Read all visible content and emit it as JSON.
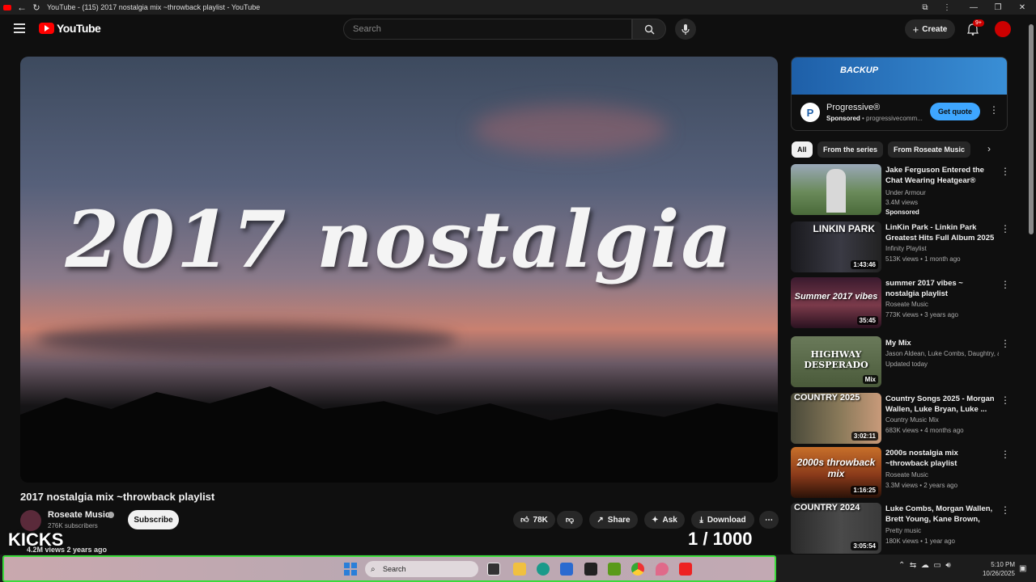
{
  "window": {
    "title": "YouTube - (115) 2017 nostalgia mix ~throwback playlist - YouTube",
    "controls": [
      "—",
      "❐",
      "✕"
    ]
  },
  "header": {
    "brand": "YouTube",
    "search_placeholder": "Search",
    "create_label": "Create",
    "notif_count": "9+"
  },
  "player": {
    "overlay_text": "2017 nostalgia",
    "overlay_bottom_left": "KICKS",
    "counter": "1  / 1000"
  },
  "video": {
    "title": "2017 nostalgia mix ~throwback playlist",
    "channel": "Roseate Music",
    "subscribers": "276K subscribers",
    "subscribe_label": "Subscribe",
    "likes": "78K",
    "share_label": "Share",
    "ask_label": "Ask",
    "download_label": "Download",
    "views_line": "4.2M views  2 years ago"
  },
  "ad": {
    "banner_text": "BACKUP",
    "advertiser": "Progressive®",
    "sponsored": "Sponsored",
    "domain": "progressivecomm...",
    "cta": "Get quote"
  },
  "chips": [
    "All",
    "From the series",
    "From Roseate Music"
  ],
  "recs": [
    {
      "title": "Jake Ferguson Entered the Chat Wearing Heatgear®",
      "channel": "Under Armour",
      "meta": "3.4M views",
      "sponsored": "Sponsored",
      "thumb_text": "",
      "duration": "",
      "thumb_color": "#5a7a4a"
    },
    {
      "title": "LinKin Park - Linkin Park Greatest Hits Full Album 2025 ...",
      "channel": "Infinity Playlist",
      "meta": "513K views • 1 month ago",
      "thumb_text": "LINKIN PARK",
      "duration": "1:43:46",
      "thumb_color": "#2a2a30"
    },
    {
      "title": "summer 2017 vibes ~ nostalgia playlist",
      "channel": "Roseate Music",
      "meta": "773K views • 3 years ago",
      "thumb_text": "Summer 2017 vibes",
      "duration": "35:45",
      "thumb_color": "#4a2a3a"
    },
    {
      "title": "My Mix",
      "channel": "Jason Aldean, Luke Combs, Daughtry, an...",
      "meta": "Updated today",
      "thumb_text": "HIGHWAY DESPERADO",
      "duration": "Mix",
      "thumb_color": "#5a6a4a"
    },
    {
      "title": "Country Songs 2025 - Morgan Wallen, Luke Bryan, Luke ...",
      "channel": "Country Music Mix",
      "meta": "683K views • 4 months ago",
      "thumb_text": "COUNTRY 2025",
      "duration": "3:02:11",
      "thumb_color": "#7a6a4a"
    },
    {
      "title": "2000s nostalgia mix ~throwback playlist",
      "channel": "Roseate Music",
      "meta": "3.3M views • 2 years ago",
      "thumb_text": "2000s throwback mix",
      "duration": "1:16:25",
      "thumb_color": "#8a4a2a"
    },
    {
      "title": "Luke Combs, Morgan Wallen, Brett Young, Kane Brown, Jas...",
      "channel": "Pretty music",
      "meta": "180K views • 1 year ago",
      "thumb_text": "COUNTRY 2024",
      "duration": "3:05:54",
      "thumb_color": "#3a3a3a"
    }
  ],
  "taskbar": {
    "search_label": "Search",
    "time": "5:10 PM",
    "date": "10/26/2025"
  }
}
